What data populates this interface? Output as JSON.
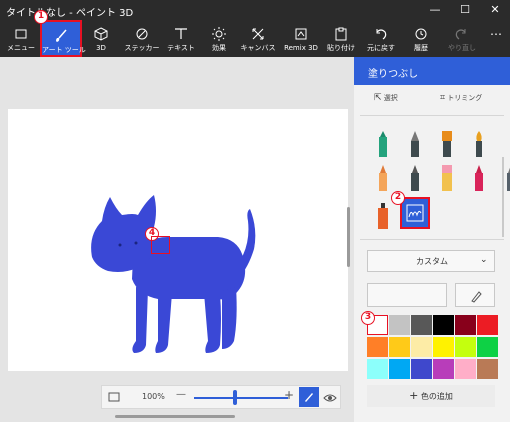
{
  "app": {
    "title": "タイトルなし - ペイント 3D"
  },
  "window": {
    "minimize": "—",
    "maximize": "☐",
    "close": "✕"
  },
  "ribbon": {
    "items": [
      {
        "label": "メニュー",
        "icon": "folder-icon"
      },
      {
        "label": "アート ツール",
        "icon": "brush-icon",
        "selected": true
      },
      {
        "label": "3D",
        "icon": "cube-icon"
      },
      {
        "label": "ステッカー",
        "icon": "sticker-icon"
      },
      {
        "label": "テキスト",
        "icon": "text-icon"
      },
      {
        "label": "効果",
        "icon": "effects-icon"
      },
      {
        "label": "キャンバス",
        "icon": "canvas-icon"
      },
      {
        "label": "Remix 3D",
        "icon": "remix-icon"
      },
      {
        "label": "貼り付け",
        "icon": "paste-icon"
      },
      {
        "label": "元に戻す",
        "icon": "undo-icon"
      },
      {
        "label": "履歴",
        "icon": "history-icon"
      },
      {
        "label": "やり直し",
        "icon": "redo-icon",
        "disabled": true
      }
    ],
    "more": "⋯"
  },
  "panel": {
    "title": "塗りつぶし",
    "select_label": "選択",
    "crop_label": "トリミング",
    "dropdown_value": "カスタム",
    "add_color_label": "色の追加",
    "add_plus": "+"
  },
  "zoom": {
    "value": "100%",
    "minus": "—",
    "plus": "+"
  },
  "annotations": {
    "n1": "1",
    "n2": "2",
    "n3": "3",
    "n4": "4"
  },
  "colors": {
    "accent": "#2f5fd8",
    "cat": "#3a48d6",
    "palette": [
      "#ffffff",
      "#c3c3c3",
      "#585858",
      "#000000",
      "#88001b",
      "#ec1c24",
      "#ff7f27",
      "#ffca18",
      "#fdeca6",
      "#fff200",
      "#c4ff0e",
      "#0ed145",
      "#8cfffb",
      "#00a8f3",
      "#3f48cc",
      "#b83dba",
      "#ffaec8",
      "#b97a56"
    ]
  }
}
